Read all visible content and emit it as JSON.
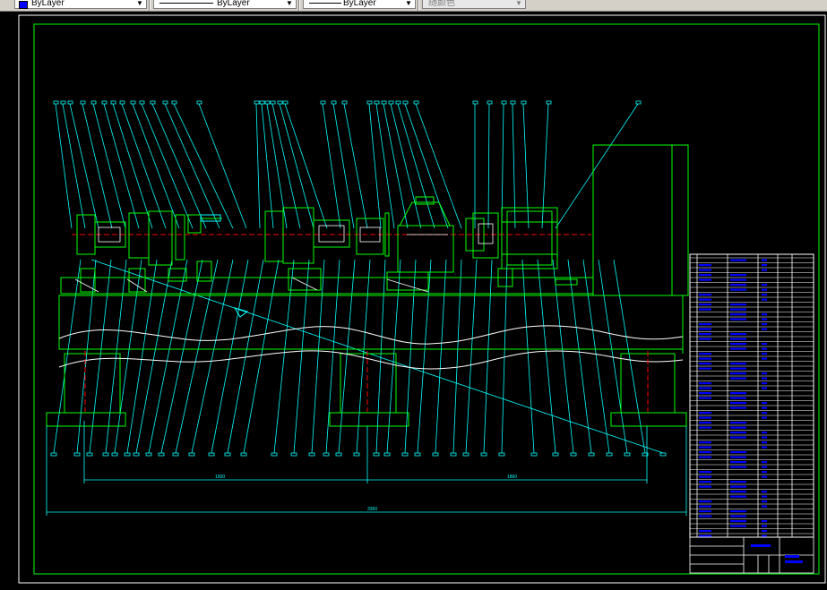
{
  "toolbar": {
    "color_control": "ByLayer",
    "linetype_control": "ByLayer",
    "lineweight_control": "ByLayer",
    "plotstyle_control": "随颜色"
  },
  "drawing": {
    "dimensions": {
      "main_total": "3360",
      "left_span": "1500",
      "right_span": "1860"
    },
    "title_block": {
      "drawing_name": "试验台总装图",
      "scale_label": "1:10"
    }
  },
  "colors": {
    "background": "#000000",
    "frame": "#00ff00",
    "leaders": "#00ffff",
    "outline": "#ffffff",
    "centerline": "#ff0000",
    "table_text": "#0000ff"
  }
}
